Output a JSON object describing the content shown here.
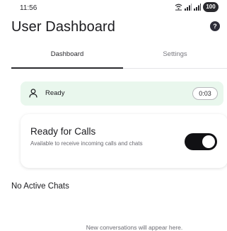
{
  "status_bar": {
    "time": "11:56",
    "battery": "100",
    "icons": [
      "wifi-calling-icon",
      "signal-icon",
      "signal-icon",
      "battery-icon"
    ]
  },
  "header": {
    "title": "User Dashboard",
    "help_glyph": "?"
  },
  "tabs": [
    {
      "label": "Dashboard",
      "active": true
    },
    {
      "label": "Settings",
      "active": false
    }
  ],
  "status": {
    "label": "Ready",
    "timer": "0:03",
    "icon": "person-icon",
    "background": "#e9f7ed"
  },
  "calls_card": {
    "title": "Ready for Calls",
    "description": "Available to receive incoming calls and chats",
    "toggle_on": true
  },
  "chats": {
    "title": "No Active Chats",
    "empty_message": "New conversations will appear here."
  }
}
